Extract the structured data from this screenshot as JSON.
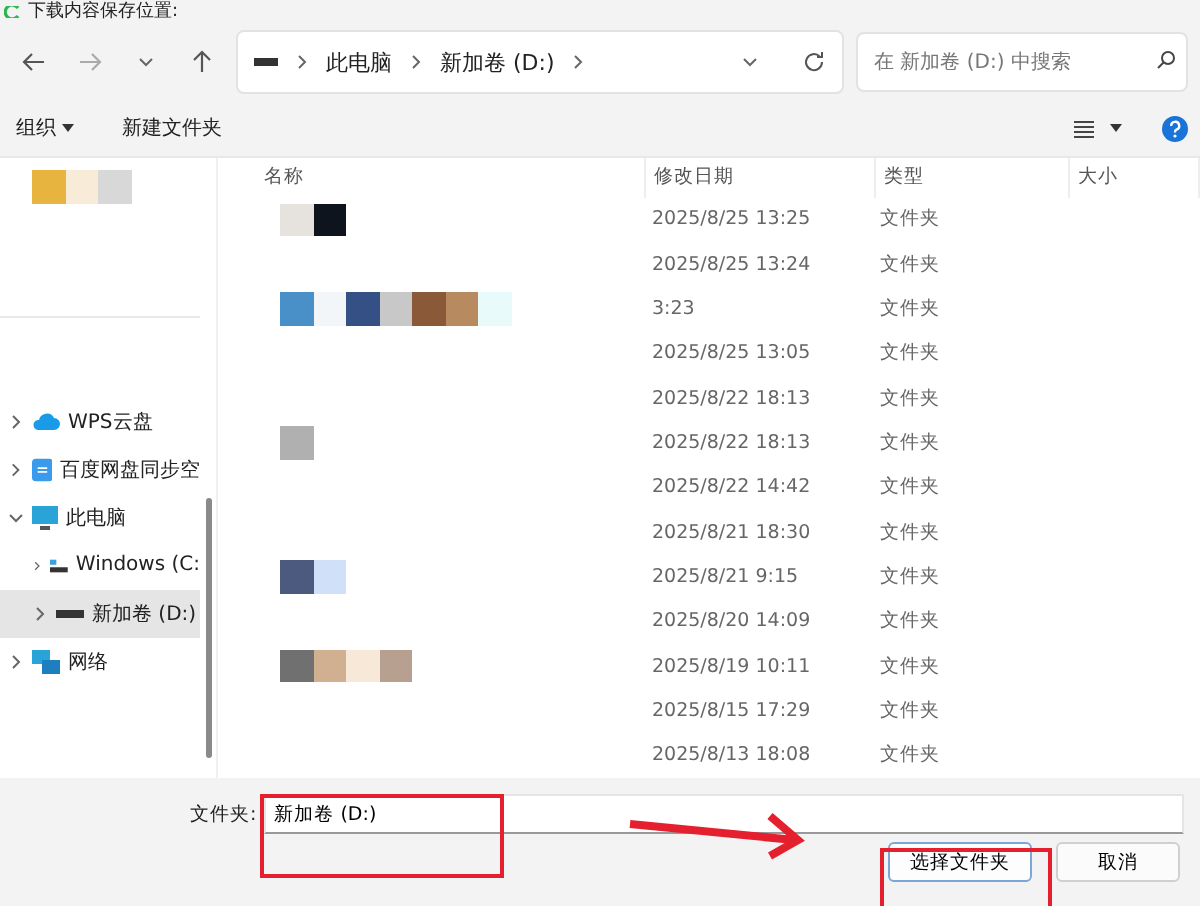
{
  "window": {
    "title": "下载内容保存位置:"
  },
  "address_bar": {
    "crumbs": [
      "此电脑",
      "新加卷 (D:)"
    ]
  },
  "search": {
    "placeholder": "在 新加卷 (D:) 中搜索"
  },
  "toolbar": {
    "organize": "组织",
    "new_folder": "新建文件夹"
  },
  "sidebar": {
    "items": [
      {
        "label": "WPS云盘",
        "kind": "cloud",
        "expanded": false,
        "selected": false
      },
      {
        "label": "百度网盘同步空",
        "kind": "sync",
        "expanded": false,
        "selected": false
      },
      {
        "label": "此电脑",
        "kind": "pc",
        "expanded": true,
        "selected": false,
        "children": [
          {
            "label": "Windows  (C:",
            "kind": "windrive",
            "expanded": false,
            "selected": false
          },
          {
            "label": "新加卷 (D:)",
            "kind": "drive",
            "expanded": false,
            "selected": true
          }
        ]
      },
      {
        "label": "网络",
        "kind": "network",
        "expanded": false,
        "selected": false
      }
    ]
  },
  "table": {
    "columns": [
      "名称",
      "修改日期",
      "类型",
      "大小"
    ],
    "rows": [
      {
        "date": "2025/8/25 13:25",
        "type": "文件夹"
      },
      {
        "date": "2025/8/25 13:24",
        "type": "文件夹"
      },
      {
        "date": "3:23",
        "type": "文件夹"
      },
      {
        "date": "2025/8/25 13:05",
        "type": "文件夹"
      },
      {
        "date": "2025/8/22 18:13",
        "type": "文件夹"
      },
      {
        "date": "2025/8/22 18:13",
        "type": "文件夹"
      },
      {
        "date": "2025/8/22 14:42",
        "type": "文件夹"
      },
      {
        "date": "2025/8/21 18:30",
        "type": "文件夹"
      },
      {
        "date": "2025/8/21 9:15",
        "type": "文件夹"
      },
      {
        "date": "2025/8/20 14:09",
        "type": "文件夹"
      },
      {
        "date": "2025/8/19 10:11",
        "type": "文件夹"
      },
      {
        "date": "2025/8/15 17:29",
        "type": "文件夹"
      },
      {
        "date": "2025/8/13 18:08",
        "type": "文件夹"
      }
    ]
  },
  "folder_field": {
    "label": "文件夹:",
    "value": "新加卷 (D:)"
  },
  "buttons": [
    "选择文件夹",
    "取消"
  ]
}
